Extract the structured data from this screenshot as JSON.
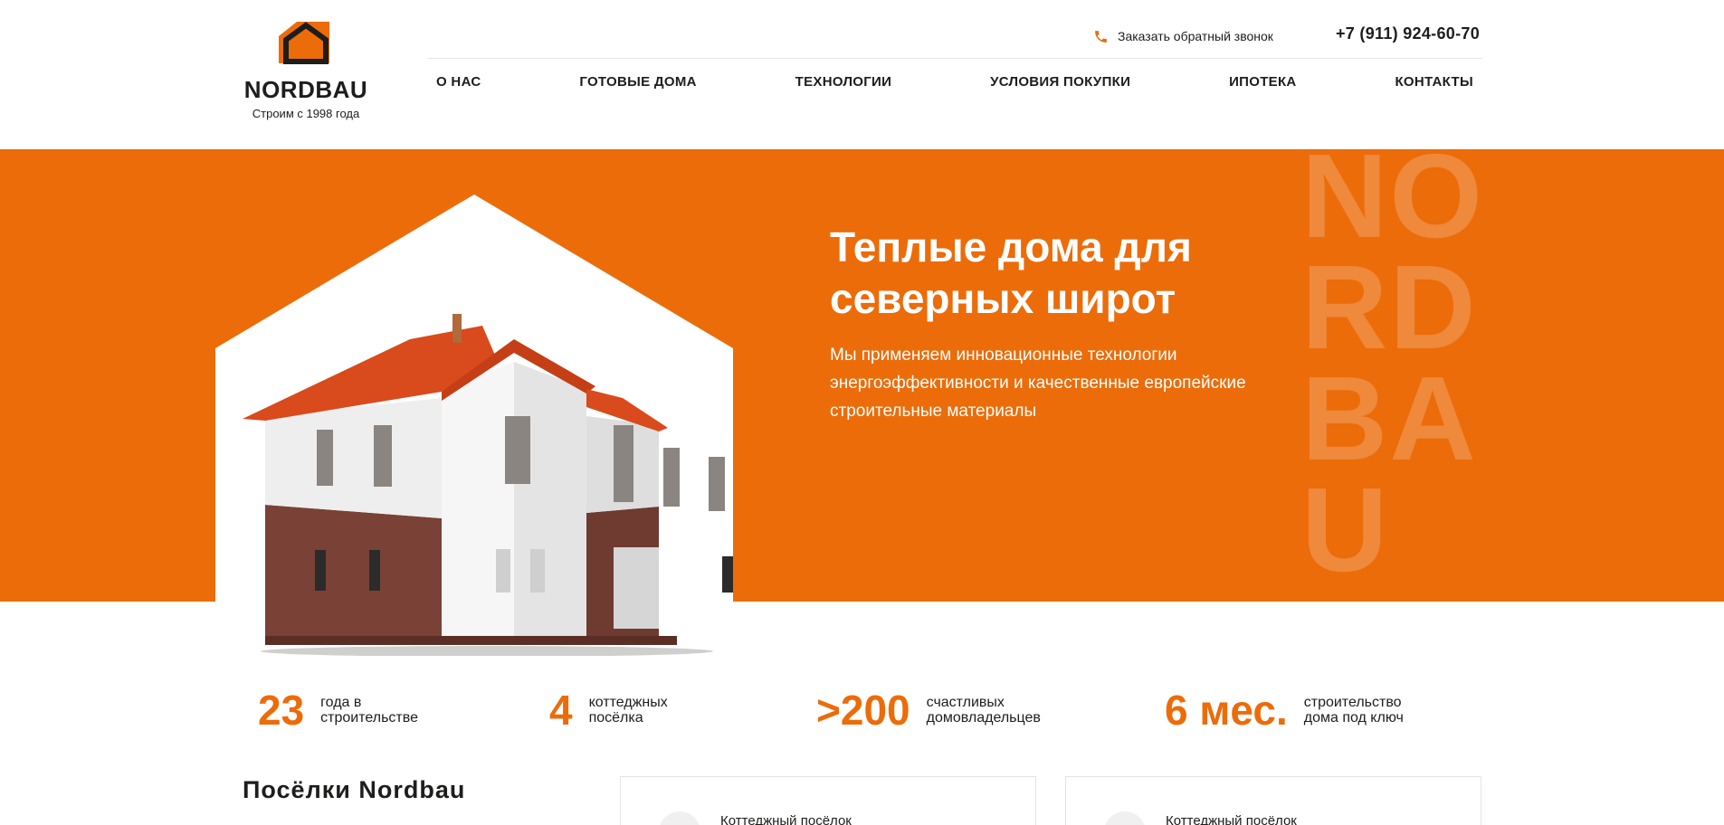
{
  "brand": {
    "name": "NORDBAU",
    "tagline": "Строим с 1998 года",
    "accent": "#ec6c0a",
    "dark": "#1d1d1b"
  },
  "header": {
    "callback_label": "Заказать обратный звонок",
    "phone": "+7 (911) 924-60-70"
  },
  "nav": {
    "items": [
      "О НАС",
      "ГОТОВЫЕ ДОМА",
      "ТЕХНОЛОГИИ",
      "УСЛОВИЯ ПОКУПКИ",
      "ИПОТЕКА",
      "КОНТАКТЫ"
    ]
  },
  "hero": {
    "title": "Теплые дома для северных широт",
    "subtitle": "Мы применяем инновационные технологии энергоэффективности и качественные европейские строительные материалы",
    "watermark": "NORDBAU"
  },
  "stats": [
    {
      "value": "23",
      "label": "года в\nстроительстве"
    },
    {
      "value": "4",
      "label": "коттеджных\nпосёлка"
    },
    {
      "value": ">200",
      "label": "счастливых\nдомовладельцев"
    },
    {
      "value": "6 мес.",
      "label": "строительство\nдома под ключ"
    }
  ],
  "villages": {
    "title": "Посёлки Nordbau",
    "cards": [
      {
        "title": "Коттеджный посёлок"
      },
      {
        "title": "Коттеджный посёлок"
      }
    ]
  },
  "icons": {
    "phone": "phone-icon",
    "logo": "house-logo-icon"
  }
}
